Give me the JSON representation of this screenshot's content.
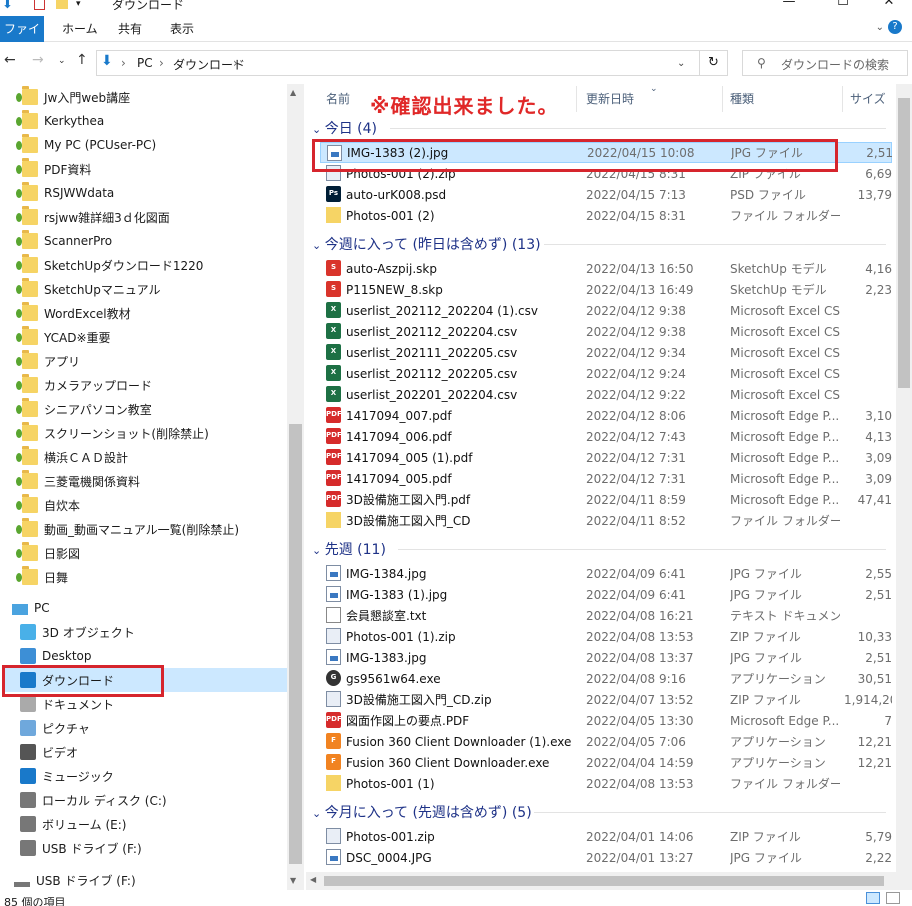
{
  "window": {
    "title": "ダウンロード",
    "minimize_glyph": "—",
    "maximize_glyph": "☐",
    "close_glyph": "✕"
  },
  "ribbon": {
    "tabs": [
      "ファイル",
      "ホーム",
      "共有",
      "表示"
    ],
    "expand_glyph": "⌄",
    "help_glyph": "?"
  },
  "address": {
    "path": [
      "PC",
      "ダウンロード"
    ],
    "search_placeholder": "ダウンロードの検索"
  },
  "sidebar": {
    "quick_access": [
      {
        "label": "Jw入門web講座"
      },
      {
        "label": "Kerkythea"
      },
      {
        "label": "My PC (PCUser-PC)"
      },
      {
        "label": "PDF資料"
      },
      {
        "label": "RSJWWdata"
      },
      {
        "label": "rsjww雑詳細3ｄ化図面"
      },
      {
        "label": "ScannerPro"
      },
      {
        "label": "SketchUpダウンロード1220"
      },
      {
        "label": "SketchUpマニュアル"
      },
      {
        "label": "WordExcel教材"
      },
      {
        "label": "YCAD※重要"
      },
      {
        "label": "アプリ"
      },
      {
        "label": "カメラアップロード"
      },
      {
        "label": "シニアパソコン教室"
      },
      {
        "label": "スクリーンショット(削除禁止)"
      },
      {
        "label": "横浜ＣＡＤ設計"
      },
      {
        "label": "三菱電機関係資料"
      },
      {
        "label": "自炊本"
      },
      {
        "label": "動画_動画マニュアル一覧(削除禁止)"
      },
      {
        "label": "日影図"
      },
      {
        "label": "日舞"
      }
    ],
    "pc_label": "PC",
    "pc_items": [
      {
        "label": "3D オブジェクト",
        "icon": "cube-icon"
      },
      {
        "label": "Desktop",
        "icon": "desktop-icon"
      },
      {
        "label": "ダウンロード",
        "icon": "download-icon"
      },
      {
        "label": "ドキュメント",
        "icon": "document-icon"
      },
      {
        "label": "ピクチャ",
        "icon": "picture-icon"
      },
      {
        "label": "ビデオ",
        "icon": "video-icon"
      },
      {
        "label": "ミュージック",
        "icon": "music-icon"
      },
      {
        "label": "ローカル ディスク (C:)",
        "icon": "disk-icon"
      },
      {
        "label": "ボリューム (E:)",
        "icon": "drive-icon"
      },
      {
        "label": "USB ドライブ (F:)",
        "icon": "usb-icon"
      }
    ],
    "usb_label": "USB ドライブ (F:)"
  },
  "columns": {
    "name": "名前",
    "date": "更新日時",
    "type": "種類",
    "size": "サイズ"
  },
  "annotation": "※確認出来ました。",
  "groups": [
    {
      "header": "今日 (4)",
      "files": [
        {
          "name": "IMG-1383 (2).jpg",
          "date": "2022/04/15 10:08",
          "type": "JPG ファイル",
          "size": "2,51",
          "icon": "img"
        },
        {
          "name": "Photos-001 (2).zip",
          "date": "2022/04/15 8:31",
          "type": "ZIP ファイル",
          "size": "6,69",
          "icon": "zip"
        },
        {
          "name": "auto-urK008.psd",
          "date": "2022/04/15 7:13",
          "type": "PSD ファイル",
          "size": "13,79",
          "icon": "psd"
        },
        {
          "name": "Photos-001 (2)",
          "date": "2022/04/15 8:31",
          "type": "ファイル フォルダー",
          "size": "",
          "icon": "folder"
        }
      ]
    },
    {
      "header": "今週に入って (昨日は含めず) (13)",
      "files": [
        {
          "name": "auto-Aszpij.skp",
          "date": "2022/04/13 16:50",
          "type": "SketchUp モデル",
          "size": "4,16",
          "icon": "skp"
        },
        {
          "name": "P115NEW_8.skp",
          "date": "2022/04/13 16:49",
          "type": "SketchUp モデル",
          "size": "2,23",
          "icon": "skp"
        },
        {
          "name": "userlist_202112_202204 (1).csv",
          "date": "2022/04/12 9:38",
          "type": "Microsoft Excel CS...",
          "size": "",
          "icon": "csv"
        },
        {
          "name": "userlist_202112_202204.csv",
          "date": "2022/04/12 9:38",
          "type": "Microsoft Excel CS...",
          "size": "",
          "icon": "csv"
        },
        {
          "name": "userlist_202111_202205.csv",
          "date": "2022/04/12 9:34",
          "type": "Microsoft Excel CS...",
          "size": "",
          "icon": "csv"
        },
        {
          "name": "userlist_202112_202205.csv",
          "date": "2022/04/12 9:24",
          "type": "Microsoft Excel CS...",
          "size": "",
          "icon": "csv"
        },
        {
          "name": "userlist_202201_202204.csv",
          "date": "2022/04/12 9:22",
          "type": "Microsoft Excel CS...",
          "size": "",
          "icon": "csv"
        },
        {
          "name": "1417094_007.pdf",
          "date": "2022/04/12 8:06",
          "type": "Microsoft Edge P...",
          "size": "3,10",
          "icon": "pdf"
        },
        {
          "name": "1417094_006.pdf",
          "date": "2022/04/12 7:43",
          "type": "Microsoft Edge P...",
          "size": "4,13",
          "icon": "pdf"
        },
        {
          "name": "1417094_005 (1).pdf",
          "date": "2022/04/12 7:31",
          "type": "Microsoft Edge P...",
          "size": "3,09",
          "icon": "pdf"
        },
        {
          "name": "1417094_005.pdf",
          "date": "2022/04/12 7:31",
          "type": "Microsoft Edge P...",
          "size": "3,09",
          "icon": "pdf"
        },
        {
          "name": "3D設備施工図入門.pdf",
          "date": "2022/04/11 8:59",
          "type": "Microsoft Edge P...",
          "size": "47,41",
          "icon": "pdf"
        },
        {
          "name": "3D設備施工図入門_CD",
          "date": "2022/04/11 8:52",
          "type": "ファイル フォルダー",
          "size": "",
          "icon": "folder"
        }
      ]
    },
    {
      "header": "先週 (11)",
      "files": [
        {
          "name": "IMG-1384.jpg",
          "date": "2022/04/09 6:41",
          "type": "JPG ファイル",
          "size": "2,55",
          "icon": "img"
        },
        {
          "name": "IMG-1383 (1).jpg",
          "date": "2022/04/09 6:41",
          "type": "JPG ファイル",
          "size": "2,51",
          "icon": "img"
        },
        {
          "name": "会員懇談室.txt",
          "date": "2022/04/08 16:21",
          "type": "テキスト ドキュメント",
          "size": "",
          "icon": "txt"
        },
        {
          "name": "Photos-001 (1).zip",
          "date": "2022/04/08 13:53",
          "type": "ZIP ファイル",
          "size": "10,33",
          "icon": "zip"
        },
        {
          "name": "IMG-1383.jpg",
          "date": "2022/04/08 13:37",
          "type": "JPG ファイル",
          "size": "2,51",
          "icon": "img"
        },
        {
          "name": "gs9561w64.exe",
          "date": "2022/04/08 9:16",
          "type": "アプリケーション",
          "size": "30,51",
          "icon": "exe"
        },
        {
          "name": "3D設備施工図入門_CD.zip",
          "date": "2022/04/07 13:52",
          "type": "ZIP ファイル",
          "size": "1,914,20",
          "icon": "zip"
        },
        {
          "name": "図面作図上の要点.PDF",
          "date": "2022/04/05 13:30",
          "type": "Microsoft Edge P...",
          "size": "7",
          "icon": "pdf"
        },
        {
          "name": "Fusion 360 Client Downloader (1).exe",
          "date": "2022/04/05 7:06",
          "type": "アプリケーション",
          "size": "12,21",
          "icon": "f360"
        },
        {
          "name": "Fusion 360 Client Downloader.exe",
          "date": "2022/04/04 14:59",
          "type": "アプリケーション",
          "size": "12,21",
          "icon": "f360"
        },
        {
          "name": "Photos-001 (1)",
          "date": "2022/04/08 13:53",
          "type": "ファイル フォルダー",
          "size": "",
          "icon": "folder"
        }
      ]
    },
    {
      "header": "今月に入って (先週は含めず) (5)",
      "files": [
        {
          "name": "Photos-001.zip",
          "date": "2022/04/01 14:06",
          "type": "ZIP ファイル",
          "size": "5,79",
          "icon": "zip"
        },
        {
          "name": "DSC_0004.JPG",
          "date": "2022/04/01 13:27",
          "type": "JPG ファイル",
          "size": "2,22",
          "icon": "img"
        }
      ]
    }
  ],
  "status": {
    "item_count": "85 個の項目"
  },
  "colors": {
    "file_tab": "#1979ca",
    "selection": "#cce8ff",
    "annotation": "#d6252d",
    "group_header": "#1e3287"
  }
}
